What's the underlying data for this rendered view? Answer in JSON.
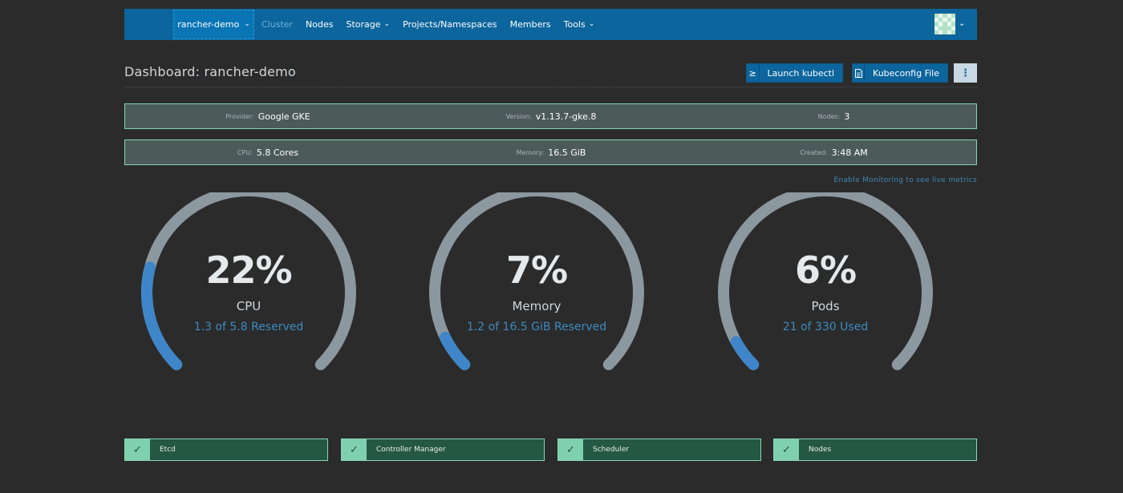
{
  "nav": {
    "cluster_selector": "rancher-demo",
    "items": [
      {
        "label": "Cluster",
        "dropdown": false,
        "active": true
      },
      {
        "label": "Nodes",
        "dropdown": false,
        "active": false
      },
      {
        "label": "Storage",
        "dropdown": true,
        "active": false
      },
      {
        "label": "Projects/Namespaces",
        "dropdown": false,
        "active": false
      },
      {
        "label": "Members",
        "dropdown": false,
        "active": false
      },
      {
        "label": "Tools",
        "dropdown": true,
        "active": false
      }
    ],
    "logo_icon": "rancher-cow-icon",
    "avatar_icon": "user-avatar-icon",
    "brand_color": "#0c659c"
  },
  "header": {
    "title": "Dashboard: rancher-demo",
    "launch_kubectl": "Launch kubectl",
    "kubeconfig_file": "Kubeconfig File",
    "more_menu": "⋮"
  },
  "info_row1": [
    {
      "label": "Provider:",
      "value": "Google GKE"
    },
    {
      "label": "Version:",
      "value": "v1.13.7-gke.8"
    },
    {
      "label": "Nodes:",
      "value": "3"
    }
  ],
  "info_row2": [
    {
      "label": "CPU:",
      "value": "5.8 Cores"
    },
    {
      "label": "Memory:",
      "value": "16.5 GiB"
    },
    {
      "label": "Created:",
      "value": "3:48 AM"
    }
  ],
  "monitoring_link": "Enable Monitoring to see live metrics",
  "gauges": [
    {
      "percent": "22%",
      "fraction": 0.22,
      "name": "CPU",
      "detail": "1.3 of 5.8 Reserved"
    },
    {
      "percent": "7%",
      "fraction": 0.07,
      "name": "Memory",
      "detail": "1.2 of 16.5 GiB Reserved"
    },
    {
      "percent": "6%",
      "fraction": 0.06,
      "name": "Pods",
      "detail": "21 of 330 Used"
    }
  ],
  "components": [
    {
      "label": "Etcd",
      "healthy": true
    },
    {
      "label": "Controller Manager",
      "healthy": true
    },
    {
      "label": "Scheduler",
      "healthy": true
    },
    {
      "label": "Nodes",
      "healthy": true
    }
  ],
  "colors": {
    "gauge_track": "#8c989f",
    "gauge_fill": "#3e86c9",
    "status_ok": "#7fd0ae"
  }
}
